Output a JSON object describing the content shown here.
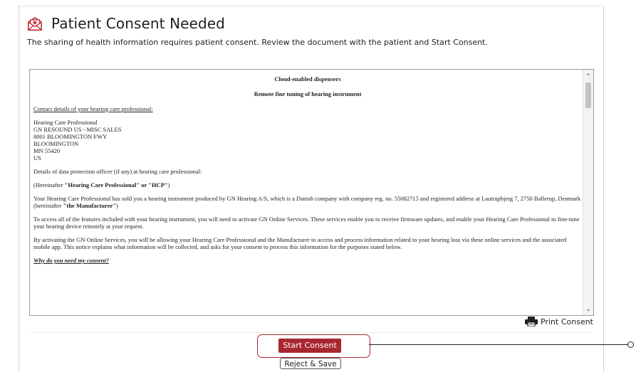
{
  "header": {
    "title": "Patient Consent Needed",
    "subtitle": "The sharing of health information requires patient consent.  Review the document with the patient and Start Consent.",
    "icon": "envelope-heart-icon"
  },
  "document": {
    "heading1": "Cloud-enabled dispensers",
    "heading2": "Remote fine tuning of hearing instrument",
    "contact_heading": "Contact details of your hearing care professional:",
    "address_lines": [
      "Hearing Care Professional",
      "GN RESOUND US - MISC SALES",
      "8001 BLOOMINGTON FWY",
      "BLOOMINGTON",
      "MN 55420",
      "US"
    ],
    "dpo": "Details of data protection officer (if any) at hearing care professional:",
    "hereinafter_prefix": "(Hereinafter ",
    "hereinafter_bold": "\"Hearing Care Professional\" or \"HCP\"",
    "hereinafter_suffix": ")",
    "para1": "Your Hearing Care Professional has sold you a hearing instrument produced by GN Hearing A/S, which is a Danish company with company reg. no. 55082715 and registered address at Lautrupbjerg 7, 2750 Ballerup, Denmark (hereinafter ",
    "para1_bold": "\"the Manufacturer\"",
    "para1_suffix": ")",
    "para2": "To access all of the features included with your hearing instrument, you will need to activate GN Online Services. These services enable you to receive firmware updates, and enable your Hearing Care Professional to fine-tune your hearing device remotely at your request.",
    "para3": "By activating the GN Online Services, you will be allowing your Hearing Care Professional and the Manufacturer to access and process information related to your hearing loss via these online services and the associated mobile app. This notice explains what information will be collected, and asks for your consent to process this information for the purposes stated below.",
    "para4": "Why do you need my consent?"
  },
  "actions": {
    "print_label": "Print Consent",
    "start_label": "Start Consent",
    "reject_label": "Reject & Save"
  },
  "colors": {
    "accent": "#a8262f",
    "outline": "#a62a35"
  }
}
